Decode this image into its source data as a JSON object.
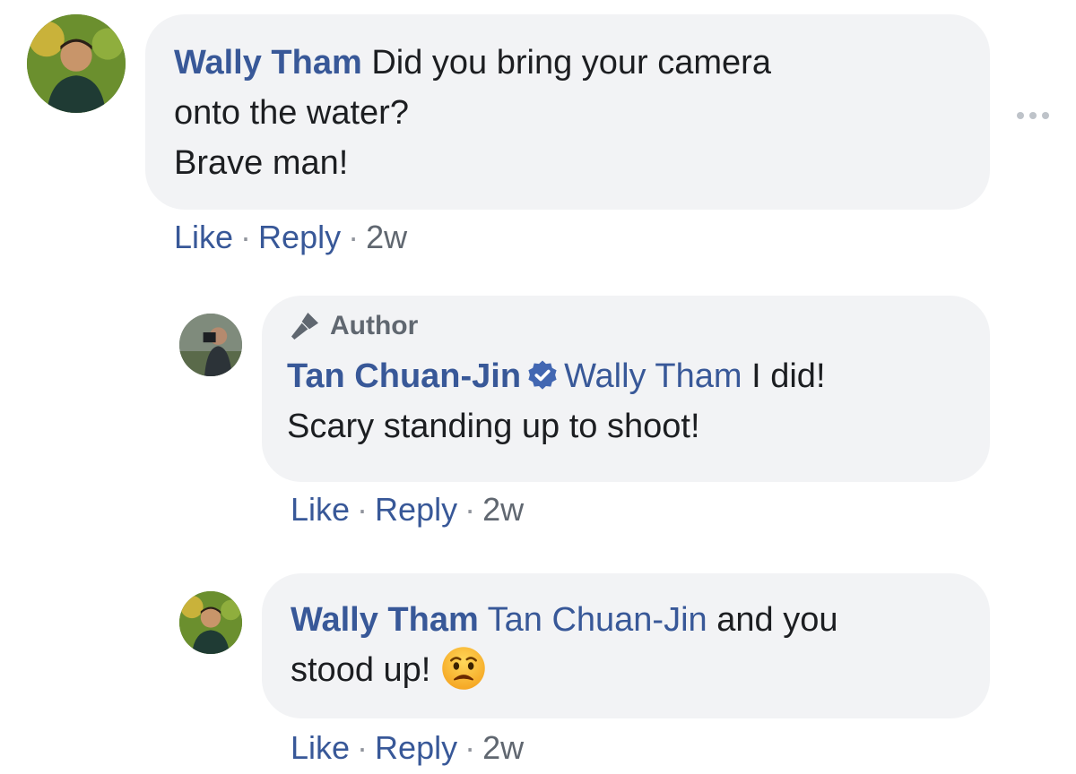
{
  "comments": [
    {
      "author": "Wally Tham",
      "lines": [
        "Did you bring your camera",
        "onto the water?",
        "Brave man!"
      ],
      "actions": {
        "like": "Like",
        "reply": "Reply",
        "time": "2w",
        "sep": "·"
      }
    },
    {
      "badge": "Author",
      "author": "Tan Chuan-Jin",
      "verified_icon": "verified-badge-icon",
      "mention": "Wally Tham",
      "line1_rest": " I did!",
      "line2": "Scary standing up to shoot!",
      "actions": {
        "like": "Like",
        "reply": "Reply",
        "time": "2w",
        "sep": "·"
      }
    },
    {
      "author": "Wally Tham",
      "mention": "Tan Chuan-Jin",
      "line1_rest": " and you",
      "line2": "stood up!",
      "emoji_icon": "worried-face-emoji",
      "actions": {
        "like": "Like",
        "reply": "Reply",
        "time": "2w",
        "sep": "·"
      }
    }
  ],
  "colors": {
    "link": "#385898",
    "bubble": "#f2f3f5",
    "text": "#1c1e21",
    "meta": "#606770"
  }
}
